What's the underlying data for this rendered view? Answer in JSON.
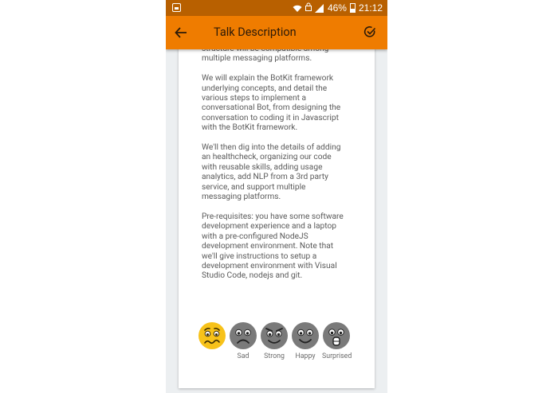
{
  "status_bar": {
    "battery": "46%",
    "time": "21:12"
  },
  "app_bar": {
    "title": "Talk Description"
  },
  "description": {
    "text": "structure will be compatible among\nmultiple messaging platforms.\n\nWe will explain the BotKit framework\nunderlying concepts, and detail the\nvarious steps to implement a\nconversational Bot, from designing the\nconversation to coding it in Javascript\nwith the BotKit framework.\n\nWe'll then dig into the details of adding\nan healthcheck, organizing our code\nwith reusable skills, adding usage\nanalytics, add NLP from a 3rd party\nservice, and support multiple\nmessaging platforms.\n\nPre-requisites: you have some software\ndevelopment experience and a laptop\nwith a pre-configured NodeJS\ndevelopment environment. Note that\nwe'll give instructions to setup a\ndevelopment environment with Visual\nStudio Code, nodejs and git."
  },
  "ratings": [
    {
      "label": "",
      "selected": true,
      "icon": "worried-face-icon"
    },
    {
      "label": "Sad",
      "selected": false,
      "icon": "sad-face-icon"
    },
    {
      "label": "Strong",
      "selected": false,
      "icon": "strong-face-icon"
    },
    {
      "label": "Happy",
      "selected": false,
      "icon": "happy-face-icon"
    },
    {
      "label": "Surprised",
      "selected": false,
      "icon": "surprised-face-icon"
    }
  ],
  "colors": {
    "app_bar": "#ef7c00",
    "status_bar": "#b86000",
    "selected_face": "#f7c21a",
    "unselected_face": "#7a7a7a"
  }
}
